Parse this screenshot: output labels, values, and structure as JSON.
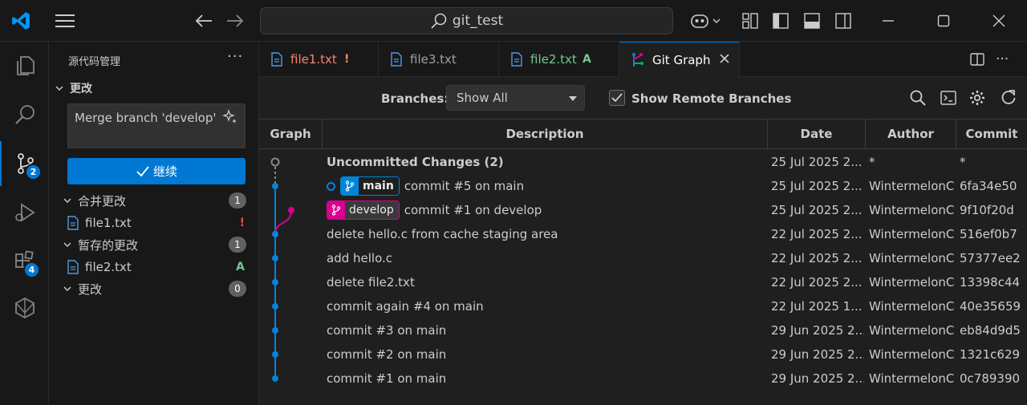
{
  "titlebar": {
    "search_text": "git_test"
  },
  "activity": {
    "scm_badge": "2",
    "extensions_badge": "4"
  },
  "sidebar": {
    "title": "源代码管理",
    "changes_header": "更改",
    "commit_message": "Merge branch 'develop'",
    "commit_button": "继续",
    "sections": [
      {
        "label": "合并更改",
        "count": "1"
      },
      {
        "label": "暂存的更改",
        "count": "1"
      },
      {
        "label": "更改",
        "count": "0"
      }
    ],
    "merge_files": [
      {
        "name": "file1.txt",
        "status": "!"
      }
    ],
    "staged_files": [
      {
        "name": "file2.txt",
        "status": "A"
      }
    ]
  },
  "tabs": [
    {
      "label": "file1.txt",
      "status": "!"
    },
    {
      "label": "file3.txt",
      "status": ""
    },
    {
      "label": "file2.txt",
      "status": "A"
    },
    {
      "label": "Git Graph",
      "status": ""
    }
  ],
  "toolbar": {
    "branches_label": "Branches:",
    "branches_value": "Show All",
    "remote_label": "Show Remote Branches"
  },
  "table": {
    "headers": {
      "graph": "Graph",
      "description": "Description",
      "date": "Date",
      "author": "Author",
      "commit": "Commit"
    },
    "rows": [
      {
        "desc": "Uncommitted Changes (2)",
        "date": "25 Jul 2025 2...",
        "author": "*",
        "commit": "*",
        "ref": "",
        "bold": true
      },
      {
        "desc": "commit #5 on main",
        "date": "25 Jul 2025 2...",
        "author": "WintermelonC",
        "commit": "6fa34e50",
        "ref": "main"
      },
      {
        "desc": "commit #1 on develop",
        "date": "25 Jul 2025 2...",
        "author": "WintermelonC",
        "commit": "9f10f20d",
        "ref": "develop"
      },
      {
        "desc": "delete hello.c from cache staging area",
        "date": "22 Jul 2025 2...",
        "author": "WintermelonC",
        "commit": "516ef0b7",
        "ref": ""
      },
      {
        "desc": "add hello.c",
        "date": "22 Jul 2025 2...",
        "author": "WintermelonC",
        "commit": "57377ee2",
        "ref": ""
      },
      {
        "desc": "delete file2.txt",
        "date": "22 Jul 2025 2...",
        "author": "WintermelonC",
        "commit": "13398c44",
        "ref": ""
      },
      {
        "desc": "commit again #4 on main",
        "date": "22 Jul 2025 1...",
        "author": "WintermelonC",
        "commit": "40e35659",
        "ref": ""
      },
      {
        "desc": "commit #3 on main",
        "date": "29 Jun 2025 2...",
        "author": "WintermelonC",
        "commit": "eb84d9d5",
        "ref": ""
      },
      {
        "desc": "commit #2 on main",
        "date": "29 Jun 2025 2...",
        "author": "WintermelonC",
        "commit": "1321c629",
        "ref": ""
      },
      {
        "desc": "commit #1 on main",
        "date": "29 Jun 2025 2...",
        "author": "WintermelonC",
        "commit": "0c789390",
        "ref": ""
      }
    ]
  },
  "colors": {
    "main_branch": "#0085d9",
    "develop_branch": "#d9008f",
    "accent": "#0078d4"
  }
}
